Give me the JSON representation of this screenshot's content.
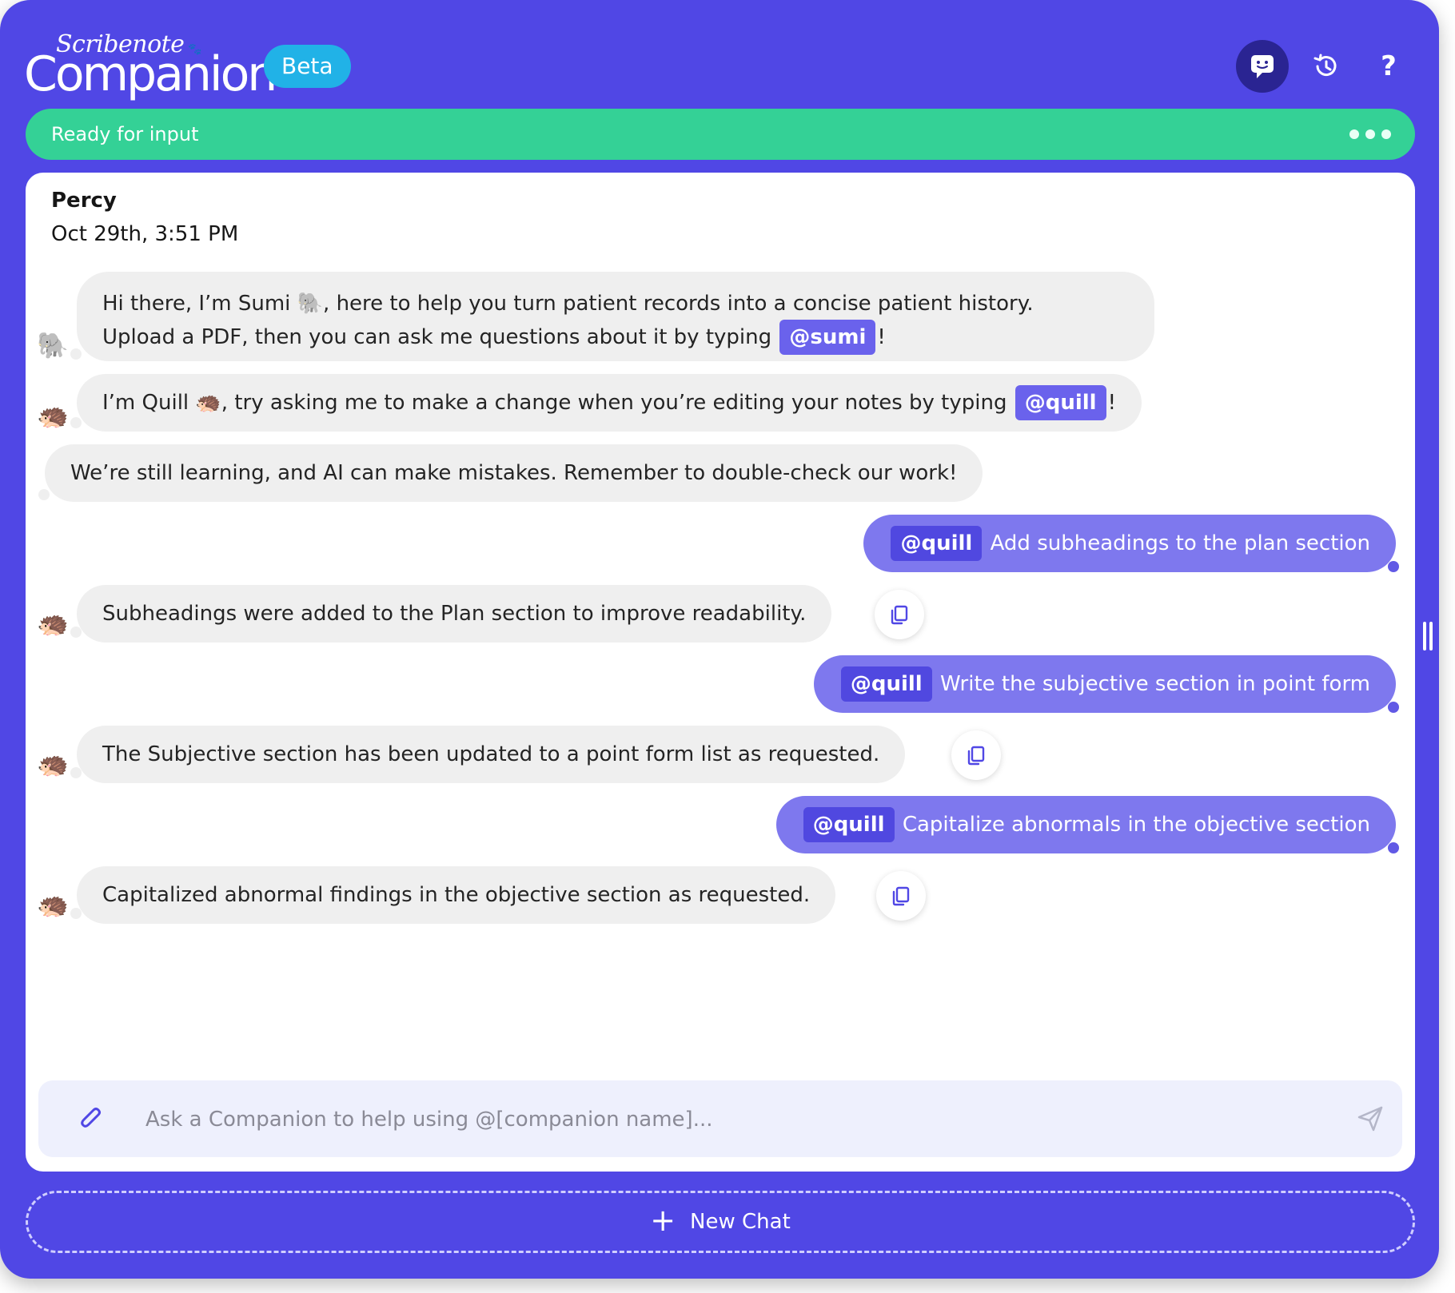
{
  "brand": {
    "script": "Scribenote",
    "name": "Companion",
    "badge": "Beta"
  },
  "header_buttons": [
    "chat-icon",
    "history-icon",
    "help-icon"
  ],
  "status": {
    "text": "Ready for input"
  },
  "chat": {
    "user": "Percy",
    "date": "Oct 29th, 3:51 PM",
    "messages": [
      {
        "role": "bot",
        "avatar": "🐘",
        "line1": "Hi there, I’m Sumi 🐘, here to help you turn patient records into a concise patient history.",
        "line2_pre": "Upload a PDF, then you can ask me questions about it by typing ",
        "tag": "@sumi",
        "line2_post": "!"
      },
      {
        "role": "bot",
        "avatar": "🦔",
        "pre": "I’m Quill 🦔, try asking me to make a change when you’re editing your notes by typing ",
        "tag": "@quill",
        "post": "!"
      },
      {
        "role": "bot",
        "avatar": "",
        "text": "We’re still learning, and AI can make mistakes. Remember to double-check our work!"
      },
      {
        "role": "user",
        "tag": "@quill",
        "text": "Add subheadings to the plan section"
      },
      {
        "role": "bot",
        "avatar": "🦔",
        "text": "Subheadings were added to the Plan section to improve readability."
      },
      {
        "role": "user",
        "tag": "@quill",
        "text": "Write the subjective section in point form"
      },
      {
        "role": "bot",
        "avatar": "🦔",
        "text": "The Subjective section has been updated to a point form list as requested."
      },
      {
        "role": "user",
        "tag": "@quill",
        "text": "Capitalize abnormals in the objective section"
      },
      {
        "role": "bot",
        "avatar": "🦔",
        "text": "Capitalized abnormal findings in the objective section as requested."
      }
    ]
  },
  "input": {
    "placeholder": "Ask a Companion to help using @[companion name]..."
  },
  "new_chat": {
    "label": "New Chat"
  },
  "colors": {
    "panel": "#5047e5",
    "status": "#34d196",
    "beta": "#21b2e7",
    "user_bubble": "#7e78ee",
    "bot_bubble": "#efefef",
    "mention": "#6a62ec"
  }
}
